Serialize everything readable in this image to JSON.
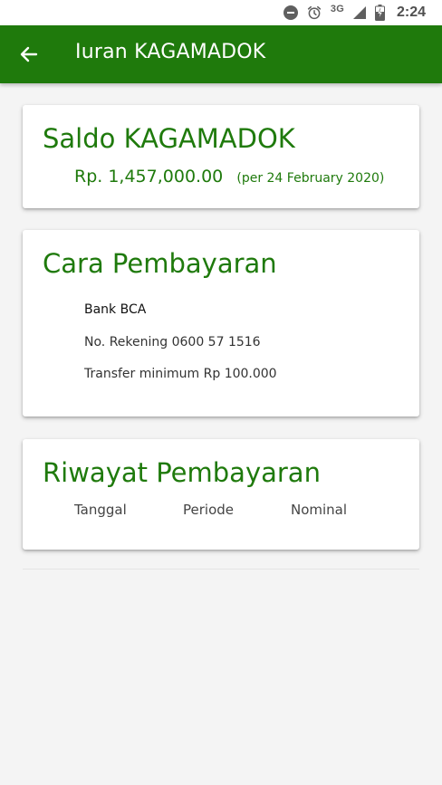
{
  "status_bar": {
    "network": "3G",
    "time": "2:24",
    "icons": [
      "do-not-disturb-icon",
      "alarm-icon",
      "signal-icon",
      "battery-charging-icon"
    ]
  },
  "app_bar": {
    "back_icon": "arrow-left-icon",
    "title": "Iuran KAGAMADOK",
    "background": "#1f7a0c"
  },
  "saldo_card": {
    "title": "Saldo KAGAMADOK",
    "amount": "Rp. 1,457,000.00",
    "as_of": "(per 24 February 2020)"
  },
  "cara_card": {
    "title": "Cara Pembayaran",
    "bank": "Bank BCA",
    "account": "No. Rekening 0600 57 1516",
    "minimum": "Transfer minimum Rp 100.000"
  },
  "riwayat_card": {
    "title": "Riwayat Pembayaran",
    "columns": [
      "Tanggal",
      "Periode",
      "Nominal"
    ]
  },
  "colors": {
    "accent": "#1f7a0c",
    "background": "#f4f4f4",
    "card": "#ffffff"
  }
}
